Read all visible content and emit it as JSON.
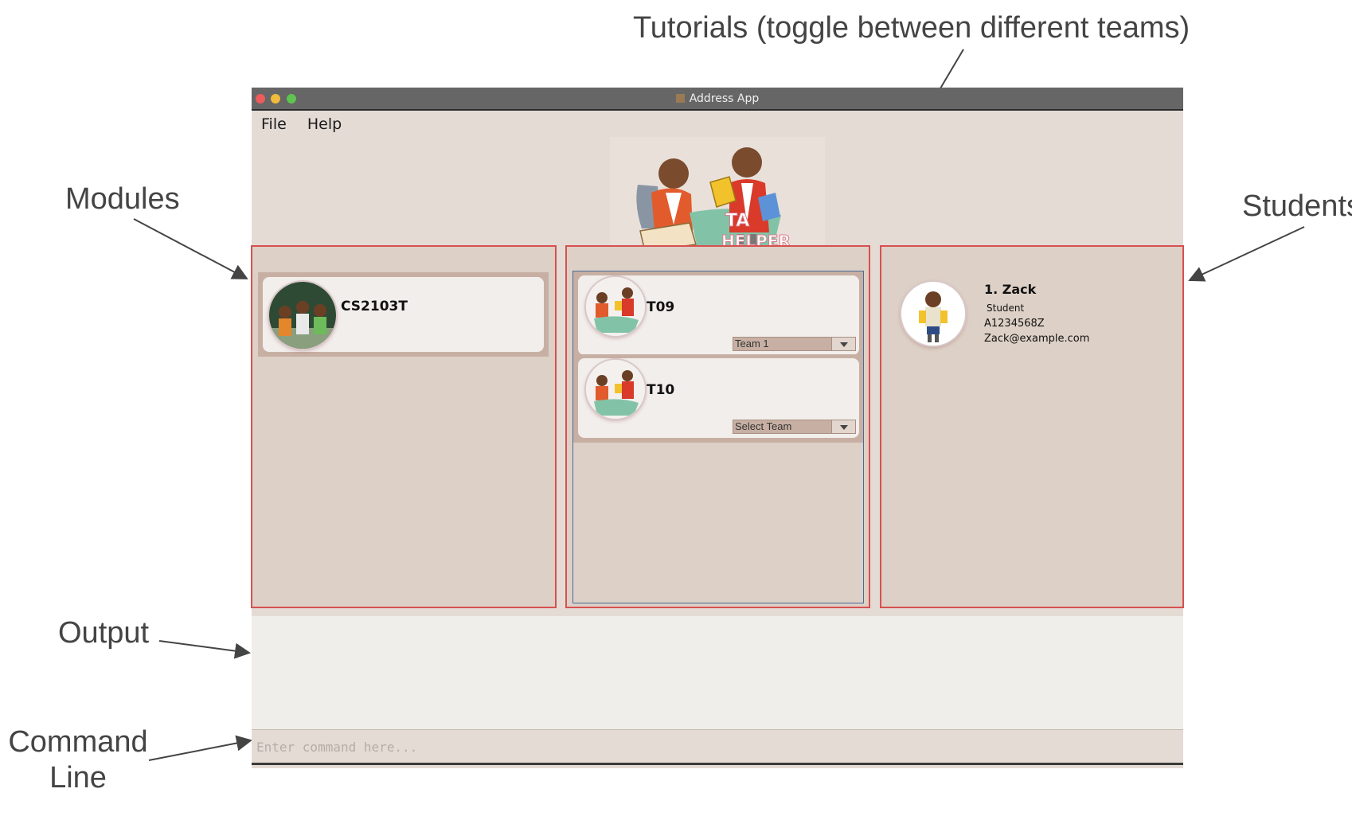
{
  "annotations": {
    "tutorials": "Tutorials (toggle between different teams)",
    "modules": "Modules",
    "students": "Students",
    "output": "Output",
    "command_line_1": "Command",
    "command_line_2": "Line"
  },
  "window": {
    "title": "Address App"
  },
  "menu": {
    "file": "File",
    "help": "Help"
  },
  "logo": {
    "text_line1": "TA",
    "text_line2": "HELPER"
  },
  "modules": [
    {
      "code": "CS2103T"
    }
  ],
  "tutorials": [
    {
      "name": "T09",
      "team_selected": "Team 1"
    },
    {
      "name": "T10",
      "team_selected": "Select Team"
    }
  ],
  "students": [
    {
      "index_name": "1.  Zack",
      "role": "Student",
      "matric": "A1234568Z",
      "email": "Zack@example.com"
    }
  ],
  "command": {
    "placeholder": "Enter command here..."
  },
  "colors": {
    "highlight_border": "#d75050",
    "panel_bg": "#ddd0c6",
    "card_bg": "#f2eeec",
    "window_bg": "#e4dbd5"
  }
}
